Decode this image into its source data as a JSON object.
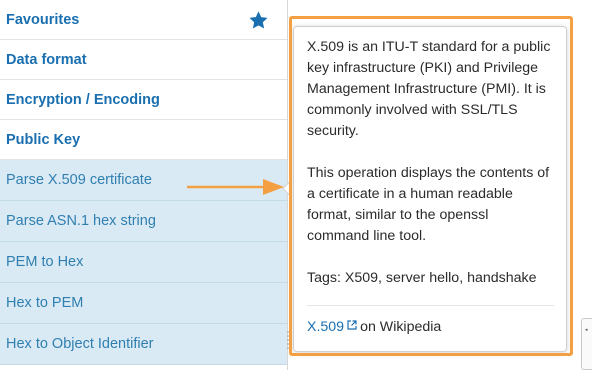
{
  "colors": {
    "accent": "#1a6fb0",
    "highlight": "#f4a042",
    "op_bg": "#daeaf4"
  },
  "sidebar": {
    "categories": [
      {
        "label": "Favourites",
        "icon": "star-icon"
      },
      {
        "label": "Data format"
      },
      {
        "label": "Encryption / Encoding"
      },
      {
        "label": "Public Key"
      }
    ],
    "operations": [
      {
        "label": "Parse X.509 certificate"
      },
      {
        "label": "Parse ASN.1 hex string"
      },
      {
        "label": "PEM to Hex"
      },
      {
        "label": "Hex to PEM"
      },
      {
        "label": "Hex to Object Identifier"
      }
    ]
  },
  "popover": {
    "para1": "X.509 is an ITU-T standard for a public key infrastructure (PKI) and Privilege Management Infrastructure (PMI). It is commonly involved with SSL/TLS security.",
    "para2": "This operation displays the contents of a certificate in a human readable format, similar to the openssl command line tool.",
    "tags": "Tags: X509, server hello, handshake",
    "wiki_link": "X.509",
    "wiki_suffix": "on Wikipedia"
  }
}
